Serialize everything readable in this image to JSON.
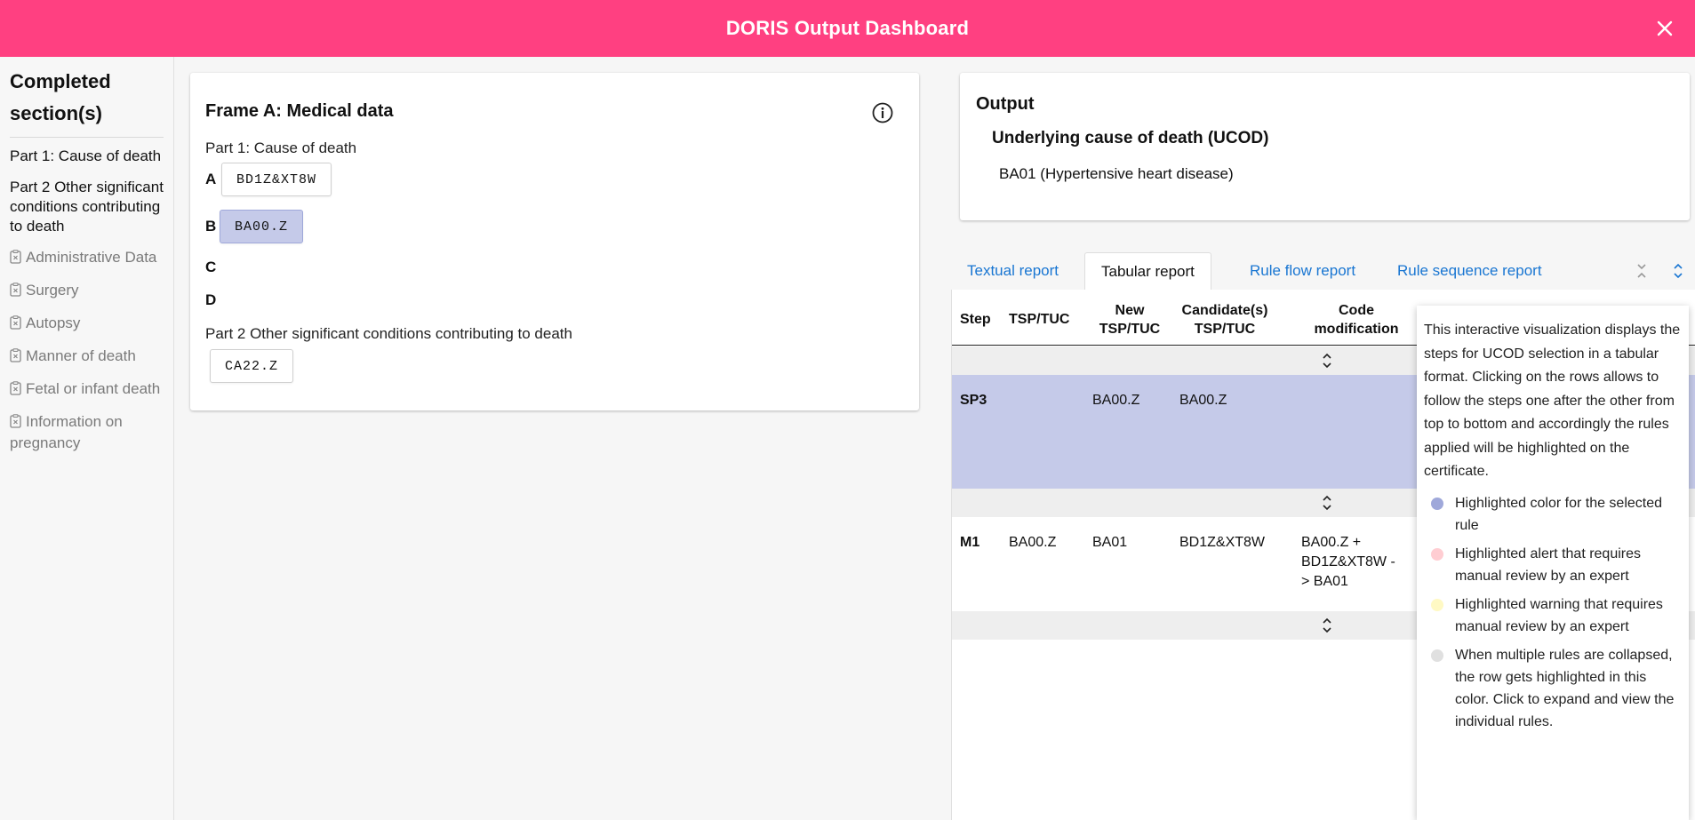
{
  "header": {
    "title": "DORIS Output Dashboard",
    "close_icon": "close-icon",
    "color": "#ff4081"
  },
  "sidebar": {
    "heading": "Completed section(s)",
    "completed": [
      "Part 1: Cause of death",
      "Part 2 Other significant conditions contributing to death"
    ],
    "pending": [
      "Administrative Data",
      "Surgery",
      "Autopsy",
      "Manner of death",
      "Fetal or infant death",
      "Information on pregnancy"
    ],
    "pending_icon": "clipboard-x-icon"
  },
  "frame": {
    "title": "Frame A: Medical data",
    "info_icon": "info-icon",
    "part1_label": "Part 1: Cause of death",
    "rows": [
      {
        "letter": "A",
        "code": "BD1Z&XT8W",
        "selected": false
      },
      {
        "letter": "B",
        "code": "BA00.Z",
        "selected": true
      },
      {
        "letter": "C",
        "code": ""
      },
      {
        "letter": "D",
        "code": ""
      }
    ],
    "part2_label": "Part 2 Other significant conditions contributing to death",
    "part2_code": "CA22.Z"
  },
  "output": {
    "title": "Output",
    "subtitle": "Underlying cause of death (UCOD)",
    "value": "BA01 (Hypertensive heart disease)"
  },
  "tabs": {
    "items": [
      "Textual report",
      "Tabular report",
      "Rule flow report",
      "Rule sequence report"
    ],
    "active": "Tabular report",
    "collapse_icon": "collapse-all-icon",
    "expand_icon": "expand-all-icon"
  },
  "table": {
    "headers": {
      "step": "Step",
      "tsp": "TSP/TUC",
      "new": "New TSP/TUC",
      "cand": "Candidate(s) TSP/TUC",
      "code": "Code modification"
    },
    "rows": [
      {
        "step": "SP3",
        "tsp": "",
        "new": "BA00.Z",
        "cand": "BA00.Z",
        "code": "",
        "selected": true
      },
      {
        "step": "M1",
        "tsp": "BA00.Z",
        "new": "BA01",
        "cand": "BD1Z&XT8W",
        "code": "BA00.Z + BD1Z&XT8W -> BA01",
        "selected": false
      }
    ],
    "expander_icon": "expand-rows-icon"
  },
  "tooltip": {
    "description": "This interactive visualization displays the steps for UCOD selection in a tabular format. Clicking on the rows allows to follow the steps one after the other from top to bottom and accordingly the rules applied will be highlighted on the certificate.",
    "legend": [
      {
        "color": "#9fa8da",
        "text": "Highlighted color for the selected rule"
      },
      {
        "color": "#ffcdd2",
        "text": "Highlighted alert that requires manual review by an expert"
      },
      {
        "color": "#fff9c4",
        "text": "Highlighted warning that requires manual review by an expert"
      },
      {
        "color": "#e0e0e0",
        "text": "When multiple rules are collapsed, the row gets highlighted in this color. Click to expand and view the individual rules."
      }
    ]
  }
}
